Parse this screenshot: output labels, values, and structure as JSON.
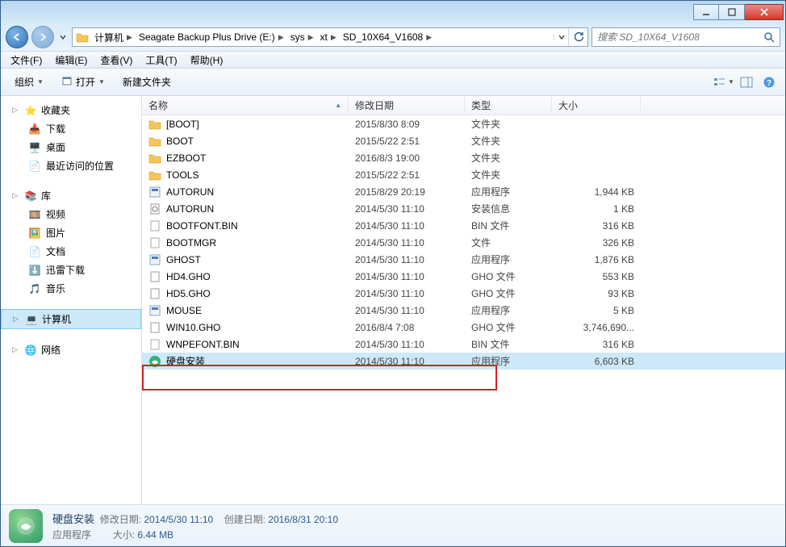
{
  "titlebar": {},
  "address": {
    "crumbs": [
      "计算机",
      "Seagate Backup Plus Drive (E:)",
      "sys",
      "xt",
      "SD_10X64_V1608"
    ]
  },
  "search": {
    "placeholder": "搜索 SD_10X64_V1608"
  },
  "menu": {
    "file": "文件(F)",
    "edit": "编辑(E)",
    "view": "查看(V)",
    "tools": "工具(T)",
    "help": "帮助(H)"
  },
  "toolbar": {
    "organize": "组织",
    "open": "打开",
    "newfolder": "新建文件夹"
  },
  "nav": {
    "favorites": {
      "label": "收藏夹",
      "items": [
        "下载",
        "桌面",
        "最近访问的位置"
      ]
    },
    "libraries": {
      "label": "库",
      "items": [
        "视频",
        "图片",
        "文档",
        "迅雷下载",
        "音乐"
      ]
    },
    "computer": {
      "label": "计算机"
    },
    "network": {
      "label": "网络"
    }
  },
  "columns": {
    "name": "名称",
    "date": "修改日期",
    "type": "类型",
    "size": "大小"
  },
  "files": [
    {
      "icon": "folder",
      "name": "[BOOT]",
      "date": "2015/8/30 8:09",
      "type": "文件夹",
      "size": ""
    },
    {
      "icon": "folder",
      "name": "BOOT",
      "date": "2015/5/22 2:51",
      "type": "文件夹",
      "size": ""
    },
    {
      "icon": "folder",
      "name": "EZBOOT",
      "date": "2016/8/3 19:00",
      "type": "文件夹",
      "size": ""
    },
    {
      "icon": "folder",
      "name": "TOOLS",
      "date": "2015/5/22 2:51",
      "type": "文件夹",
      "size": ""
    },
    {
      "icon": "exe",
      "name": "AUTORUN",
      "date": "2015/8/29 20:19",
      "type": "应用程序",
      "size": "1,944 KB"
    },
    {
      "icon": "ini",
      "name": "AUTORUN",
      "date": "2014/5/30 11:10",
      "type": "安装信息",
      "size": "1 KB"
    },
    {
      "icon": "file",
      "name": "BOOTFONT.BIN",
      "date": "2014/5/30 11:10",
      "type": "BIN 文件",
      "size": "316 KB"
    },
    {
      "icon": "file",
      "name": "BOOTMGR",
      "date": "2014/5/30 11:10",
      "type": "文件",
      "size": "326 KB"
    },
    {
      "icon": "exe",
      "name": "GHOST",
      "date": "2014/5/30 11:10",
      "type": "应用程序",
      "size": "1,876 KB"
    },
    {
      "icon": "gho",
      "name": "HD4.GHO",
      "date": "2014/5/30 11:10",
      "type": "GHO 文件",
      "size": "553 KB"
    },
    {
      "icon": "gho",
      "name": "HD5.GHO",
      "date": "2014/5/30 11:10",
      "type": "GHO 文件",
      "size": "93 KB"
    },
    {
      "icon": "exe",
      "name": "MOUSE",
      "date": "2014/5/30 11:10",
      "type": "应用程序",
      "size": "5 KB"
    },
    {
      "icon": "gho",
      "name": "WIN10.GHO",
      "date": "2016/8/4 7:08",
      "type": "GHO 文件",
      "size": "3,746,690..."
    },
    {
      "icon": "file",
      "name": "WNPEFONT.BIN",
      "date": "2014/5/30 11:10",
      "type": "BIN 文件",
      "size": "316 KB"
    },
    {
      "icon": "app",
      "name": "硬盘安装",
      "date": "2014/5/30 11:10",
      "type": "应用程序",
      "size": "6,603 KB",
      "selected": true
    }
  ],
  "details": {
    "title": "硬盘安装",
    "subtitle": "应用程序",
    "mod_label": "修改日期:",
    "mod_val": "2014/5/30 11:10",
    "size_label": "大小:",
    "size_val": "6.44 MB",
    "create_label": "创建日期:",
    "create_val": "2016/8/31 20:10"
  }
}
